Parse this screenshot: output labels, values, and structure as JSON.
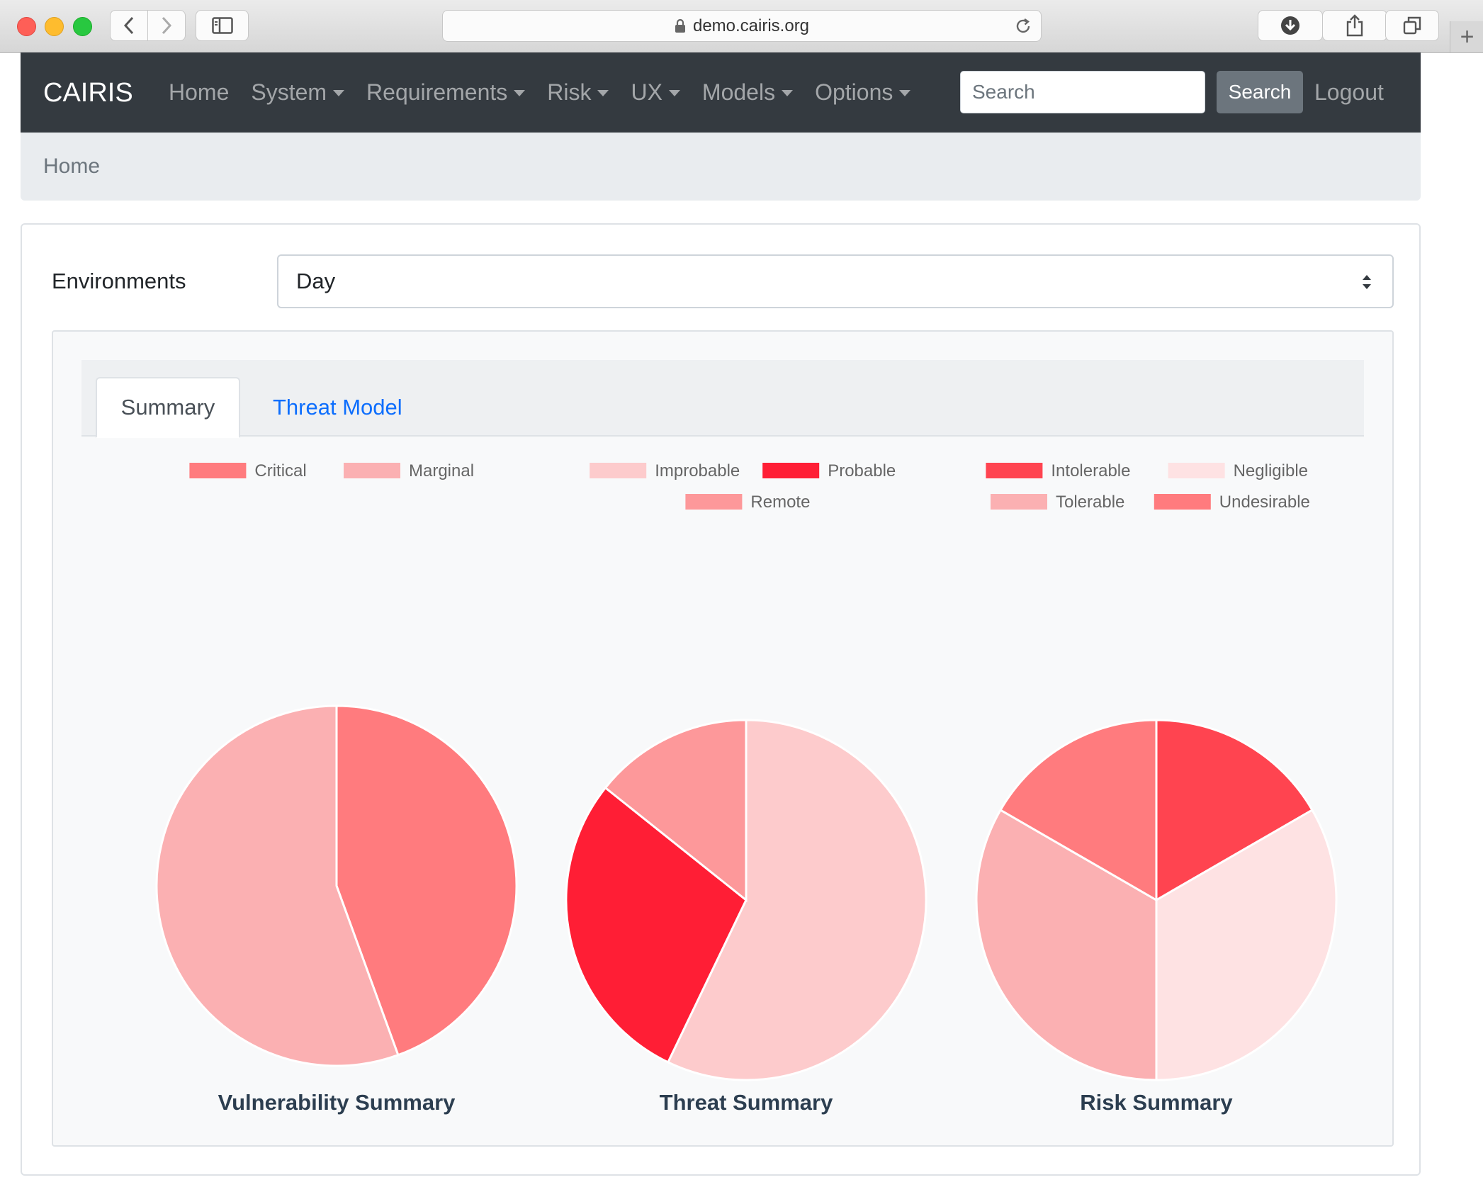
{
  "browser": {
    "url": "demo.cairis.org"
  },
  "navbar": {
    "brand": "CAIRIS",
    "links": [
      {
        "label": "Home",
        "dropdown": false
      },
      {
        "label": "System",
        "dropdown": true
      },
      {
        "label": "Requirements",
        "dropdown": true
      },
      {
        "label": "Risk",
        "dropdown": true
      },
      {
        "label": "UX",
        "dropdown": true
      },
      {
        "label": "Models",
        "dropdown": true
      },
      {
        "label": "Options",
        "dropdown": true
      }
    ],
    "search_placeholder": "Search",
    "search_button": "Search",
    "logout": "Logout"
  },
  "breadcrumb": "Home",
  "environments": {
    "label": "Environments",
    "selected": "Day"
  },
  "tabs": {
    "active": "Summary",
    "other": "Threat Model"
  },
  "chart_data": [
    {
      "type": "pie",
      "title": "Vulnerability Summary",
      "legend": [
        "Critical",
        "Marginal"
      ],
      "slices": [
        {
          "label": "Critical",
          "value": 4,
          "color": "#ff7b7e"
        },
        {
          "label": "Marginal",
          "value": 5,
          "color": "#fbb0b2"
        }
      ]
    },
    {
      "type": "pie",
      "title": "Threat Summary",
      "legend": [
        "Improbable",
        "Probable",
        "Remote"
      ],
      "slices": [
        {
          "label": "Improbable",
          "value": 4,
          "color": "#fdcbcc"
        },
        {
          "label": "Probable",
          "value": 2,
          "color": "#ff1e35"
        },
        {
          "label": "Remote",
          "value": 1,
          "color": "#fd989a"
        }
      ]
    },
    {
      "type": "pie",
      "title": "Risk Summary",
      "legend": [
        "Intolerable",
        "Negligible",
        "Tolerable",
        "Undesirable"
      ],
      "slices": [
        {
          "label": "Intolerable",
          "value": 1,
          "color": "#ff4450"
        },
        {
          "label": "Negligible",
          "value": 2,
          "color": "#fee2e3"
        },
        {
          "label": "Tolerable",
          "value": 2,
          "color": "#fbb0b2"
        },
        {
          "label": "Undesirable",
          "value": 1,
          "color": "#ff7b7e"
        }
      ]
    }
  ]
}
